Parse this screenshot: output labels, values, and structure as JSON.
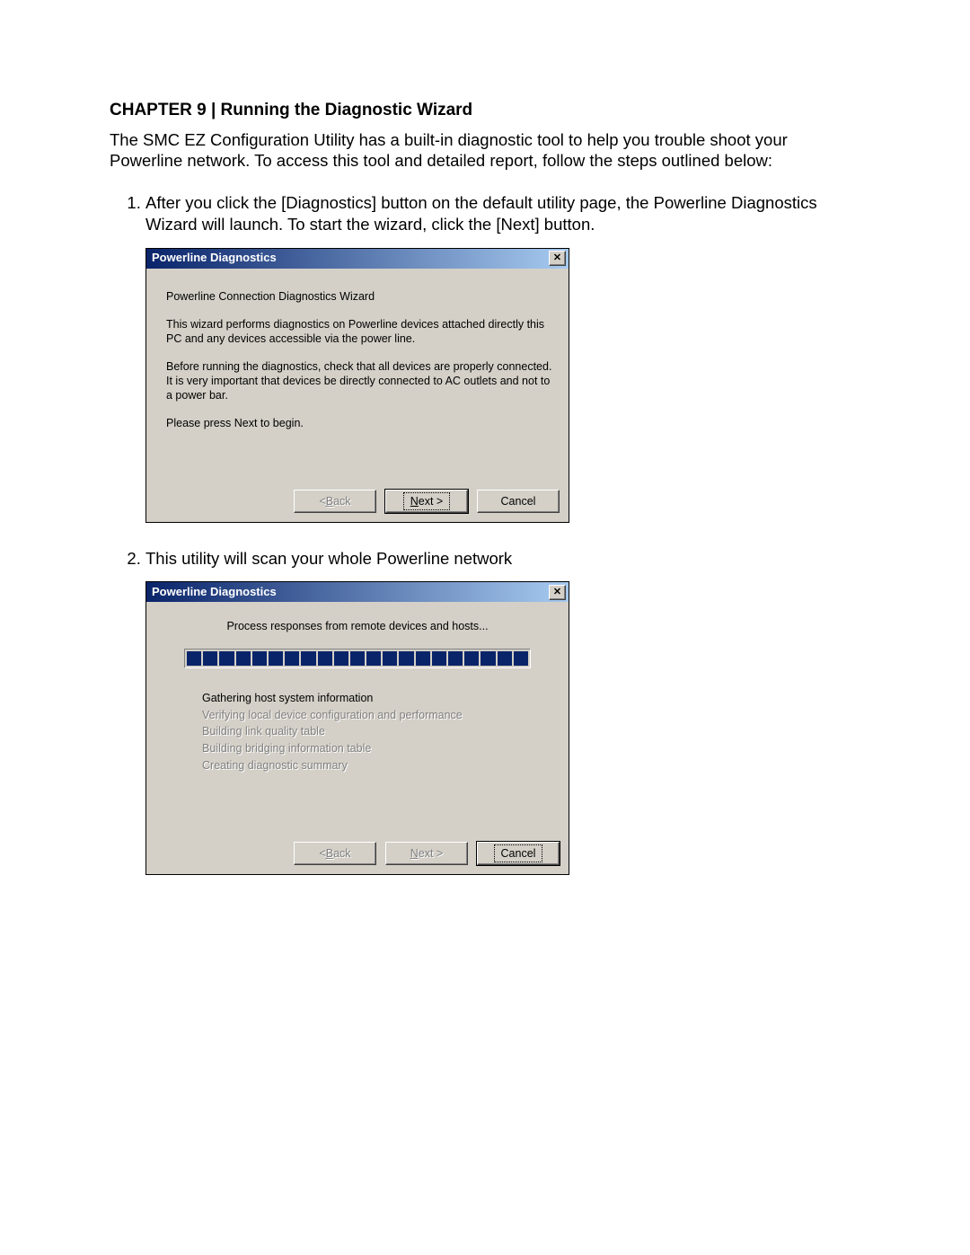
{
  "heading": "CHAPTER 9 | Running the Diagnostic Wizard",
  "intro": "The SMC EZ Configuration Utility has a built-in diagnostic tool to help you trouble shoot your Powerline network.  To access this tool and detailed report, follow the steps outlined below:",
  "steps": [
    "After you click the [Diagnostics] button on the default utility page, the Powerline Diagnostics Wizard will launch.  To start the wizard, click the [Next] button.",
    "This utility will scan your whole Powerline network"
  ],
  "dialog1": {
    "title": "Powerline Diagnostics",
    "close_glyph": "✕",
    "p1": "Powerline Connection Diagnostics Wizard",
    "p2": "This wizard performs diagnostics on Powerline devices attached directly this PC and any devices accessible via the power line.",
    "p3": "Before running the diagnostics, check that all devices are properly connected. It is very important that devices be directly connected to AC outlets and not to a power bar.",
    "p4": "Please press Next to begin.",
    "buttons": {
      "back_pre": "< ",
      "back_u": "B",
      "back_post": "ack",
      "next_u": "N",
      "next_post": "ext >",
      "cancel": "Cancel"
    }
  },
  "dialog2": {
    "title": "Powerline Diagnostics",
    "close_glyph": "✕",
    "status": "Process responses from remote devices and hosts...",
    "progress_segments": 21,
    "tasks": [
      {
        "label": "Gathering host system information",
        "state": "done"
      },
      {
        "label": "Verifying local device configuration and performance",
        "state": "pending"
      },
      {
        "label": "Building link quality table",
        "state": "pending"
      },
      {
        "label": "Building bridging information table",
        "state": "pending"
      },
      {
        "label": "Creating diagnostic summary",
        "state": "pending"
      }
    ],
    "buttons": {
      "back_pre": "< ",
      "back_u": "B",
      "back_post": "ack",
      "next_u": "N",
      "next_post": "ext >",
      "cancel": "Cancel"
    }
  }
}
